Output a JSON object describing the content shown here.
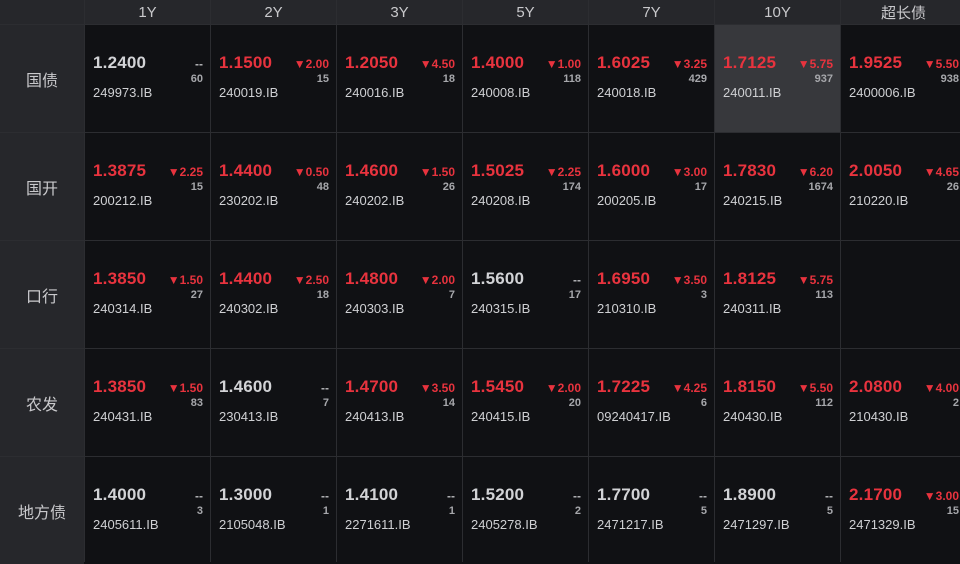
{
  "columns": [
    "1Y",
    "2Y",
    "3Y",
    "5Y",
    "7Y",
    "10Y",
    "超长债"
  ],
  "colors": {
    "down": "#e8333e",
    "flat": "#d2d3d6",
    "highlight_bg": "#37383c"
  },
  "rows": [
    {
      "label": "国债",
      "cells": [
        {
          "yield": "1.2400",
          "change": "--",
          "count": "60",
          "code": "249973.IB",
          "dir": "flat"
        },
        {
          "yield": "1.1500",
          "change": "▼2.00",
          "count": "15",
          "code": "240019.IB",
          "dir": "down"
        },
        {
          "yield": "1.2050",
          "change": "▼4.50",
          "count": "18",
          "code": "240016.IB",
          "dir": "down"
        },
        {
          "yield": "1.4000",
          "change": "▼1.00",
          "count": "118",
          "code": "240008.IB",
          "dir": "down"
        },
        {
          "yield": "1.6025",
          "change": "▼3.25",
          "count": "429",
          "code": "240018.IB",
          "dir": "down"
        },
        {
          "yield": "1.7125",
          "change": "▼5.75",
          "count": "937",
          "code": "240011.IB",
          "dir": "down",
          "highlight": true
        },
        {
          "yield": "1.9525",
          "change": "▼5.50",
          "count": "938",
          "code": "2400006.IB",
          "dir": "down"
        }
      ]
    },
    {
      "label": "国开",
      "cells": [
        {
          "yield": "1.3875",
          "change": "▼2.25",
          "count": "15",
          "code": "200212.IB",
          "dir": "down"
        },
        {
          "yield": "1.4400",
          "change": "▼0.50",
          "count": "48",
          "code": "230202.IB",
          "dir": "down"
        },
        {
          "yield": "1.4600",
          "change": "▼1.50",
          "count": "26",
          "code": "240202.IB",
          "dir": "down"
        },
        {
          "yield": "1.5025",
          "change": "▼2.25",
          "count": "174",
          "code": "240208.IB",
          "dir": "down"
        },
        {
          "yield": "1.6000",
          "change": "▼3.00",
          "count": "17",
          "code": "200205.IB",
          "dir": "down"
        },
        {
          "yield": "1.7830",
          "change": "▼6.20",
          "count": "1674",
          "code": "240215.IB",
          "dir": "down"
        },
        {
          "yield": "2.0050",
          "change": "▼4.65",
          "count": "26",
          "code": "210220.IB",
          "dir": "down"
        }
      ]
    },
    {
      "label": "口行",
      "cells": [
        {
          "yield": "1.3850",
          "change": "▼1.50",
          "count": "27",
          "code": "240314.IB",
          "dir": "down"
        },
        {
          "yield": "1.4400",
          "change": "▼2.50",
          "count": "18",
          "code": "240302.IB",
          "dir": "down"
        },
        {
          "yield": "1.4800",
          "change": "▼2.00",
          "count": "7",
          "code": "240303.IB",
          "dir": "down"
        },
        {
          "yield": "1.5600",
          "change": "--",
          "count": "17",
          "code": "240315.IB",
          "dir": "flat"
        },
        {
          "yield": "1.6950",
          "change": "▼3.50",
          "count": "3",
          "code": "210310.IB",
          "dir": "down"
        },
        {
          "yield": "1.8125",
          "change": "▼5.75",
          "count": "113",
          "code": "240311.IB",
          "dir": "down"
        },
        null
      ]
    },
    {
      "label": "农发",
      "cells": [
        {
          "yield": "1.3850",
          "change": "▼1.50",
          "count": "83",
          "code": "240431.IB",
          "dir": "down"
        },
        {
          "yield": "1.4600",
          "change": "--",
          "count": "7",
          "code": "230413.IB",
          "dir": "flat"
        },
        {
          "yield": "1.4700",
          "change": "▼3.50",
          "count": "14",
          "code": "240413.IB",
          "dir": "down"
        },
        {
          "yield": "1.5450",
          "change": "▼2.00",
          "count": "20",
          "code": "240415.IB",
          "dir": "down"
        },
        {
          "yield": "1.7225",
          "change": "▼4.25",
          "count": "6",
          "code": "09240417.IB",
          "dir": "down"
        },
        {
          "yield": "1.8150",
          "change": "▼5.50",
          "count": "112",
          "code": "240430.IB",
          "dir": "down"
        },
        {
          "yield": "2.0800",
          "change": "▼4.00",
          "count": "2",
          "code": "210430.IB",
          "dir": "down"
        }
      ]
    },
    {
      "label": "地方债",
      "cells": [
        {
          "yield": "1.4000",
          "change": "--",
          "count": "3",
          "code": "2405611.IB",
          "dir": "flat"
        },
        {
          "yield": "1.3000",
          "change": "--",
          "count": "1",
          "code": "2105048.IB",
          "dir": "flat"
        },
        {
          "yield": "1.4100",
          "change": "--",
          "count": "1",
          "code": "2271611.IB",
          "dir": "flat"
        },
        {
          "yield": "1.5200",
          "change": "--",
          "count": "2",
          "code": "2405278.IB",
          "dir": "flat"
        },
        {
          "yield": "1.7700",
          "change": "--",
          "count": "5",
          "code": "2471217.IB",
          "dir": "flat"
        },
        {
          "yield": "1.8900",
          "change": "--",
          "count": "5",
          "code": "2471297.IB",
          "dir": "flat"
        },
        {
          "yield": "2.1700",
          "change": "▼3.00",
          "count": "15",
          "code": "2471329.IB",
          "dir": "down"
        }
      ]
    }
  ]
}
